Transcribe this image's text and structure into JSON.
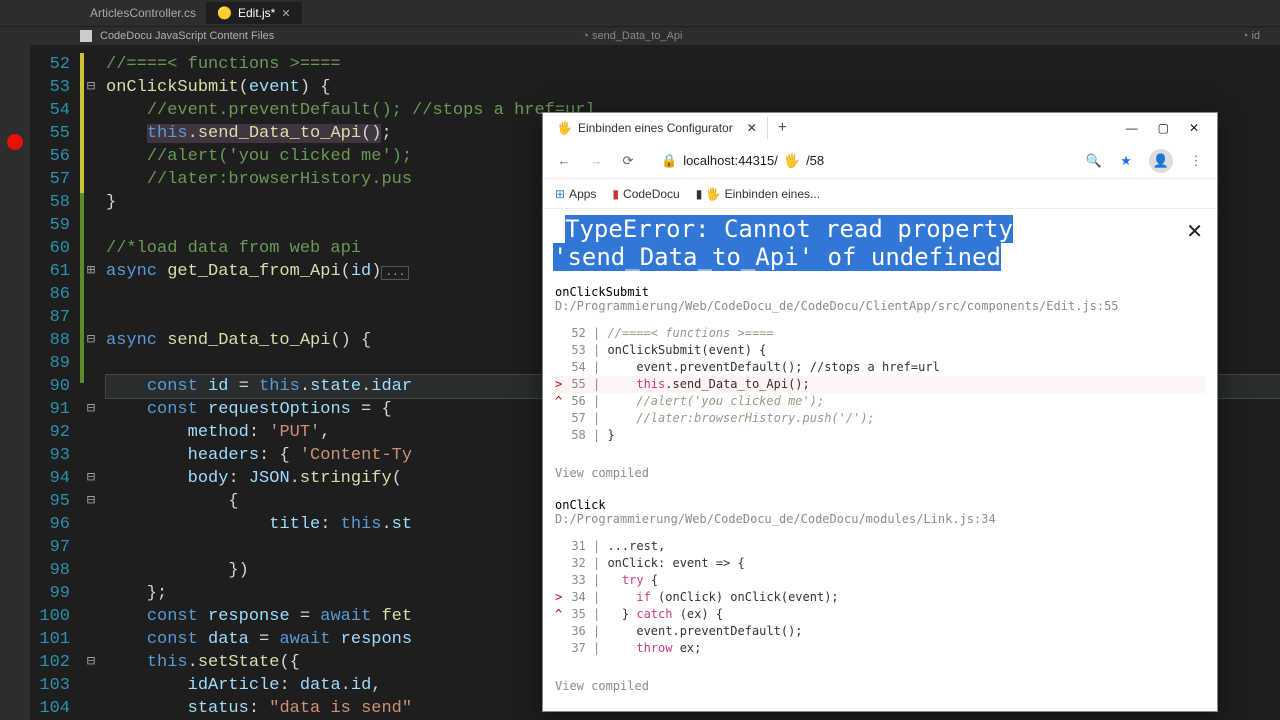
{
  "tabs": [
    {
      "label": "ArticlesController.cs",
      "active": false
    },
    {
      "label": "Edit.js*",
      "icon": "🟡",
      "active": true,
      "closeable": true
    }
  ],
  "docfiles": {
    "left": "CodeDocu JavaScript Content Files",
    "mid": "send_Data_to_Api",
    "right": "id"
  },
  "line_numbers": [
    "52",
    "53",
    "54",
    "55",
    "56",
    "57",
    "58",
    "59",
    "60",
    "61",
    "86",
    "87",
    "88",
    "89",
    "90",
    "91",
    "92",
    "93",
    "94",
    "95",
    "96",
    "97",
    "98",
    "99",
    "100",
    "101",
    "102",
    "103",
    "104"
  ],
  "fold_marks": [
    "",
    "-",
    "",
    "",
    "",
    "",
    "",
    "",
    "",
    "+",
    "",
    "",
    "-",
    "",
    "",
    "-",
    "",
    "",
    "-",
    "-",
    "",
    "",
    "",
    "",
    "",
    "",
    "-",
    "",
    ""
  ],
  "code_lines": [
    {
      "html": "<span class='c-comment'>//====&lt; functions &gt;====</span>"
    },
    {
      "html": "<span class='c-method'>onClickSubmit</span>(<span class='c-var'>event</span>) {"
    },
    {
      "html": "    <span class='c-comment'>//event.preventDefault(); //stops a href=url</span>"
    },
    {
      "html": "    <span class='c-hilite'><span class='c-keyword'>this</span>.<span class='c-method'>send_Data_to_Api</span>()</span>;"
    },
    {
      "html": "    <span class='c-comment'>//alert('you clicked me');</span>"
    },
    {
      "html": "    <span class='c-comment'>//later:browserHistory.pus</span>"
    },
    {
      "html": "}"
    },
    {
      "html": ""
    },
    {
      "html": "<span class='c-comment'>//*load data from web api</span>"
    },
    {
      "html": "<span class='c-keyword'>async</span> <span class='c-method'>get_Data_from_Api</span>(<span class='c-var'>id</span>)<span class='c-dots'>...</span>"
    },
    {
      "html": ""
    },
    {
      "html": ""
    },
    {
      "html": "<span class='c-keyword'>async</span> <span class='c-method'>send_Data_to_Api</span>() {"
    },
    {
      "html": ""
    },
    {
      "html": "    <span class='c-keyword'>const</span> <span class='c-var'>id</span> = <span class='c-keyword'>this</span>.<span class='c-var'>state</span>.<span class='c-var'>idar</span>",
      "current": true
    },
    {
      "html": "    <span class='c-keyword'>const</span> <span class='c-var'>requestOptions</span> = {"
    },
    {
      "html": "        <span class='c-var'>method</span>: <span class='c-string'>'PUT'</span>,"
    },
    {
      "html": "        <span class='c-var'>headers</span>: { <span class='c-string'>'Content-Ty</span>"
    },
    {
      "html": "        <span class='c-var'>body</span>: <span class='c-var'>JSON</span>.<span class='c-method'>stringify</span>("
    },
    {
      "html": "            {"
    },
    {
      "html": "                <span class='c-var'>title</span>: <span class='c-keyword'>this</span>.<span class='c-var'>st</span>"
    },
    {
      "html": ""
    },
    {
      "html": "            })"
    },
    {
      "html": "    };"
    },
    {
      "html": "    <span class='c-keyword'>const</span> <span class='c-var'>response</span> = <span class='c-keyword'>await</span> <span class='c-method'>fet</span>"
    },
    {
      "html": "    <span class='c-keyword'>const</span> <span class='c-var'>data</span> = <span class='c-keyword'>await</span> <span class='c-var'>respons</span>"
    },
    {
      "html": "    <span class='c-keyword'>this</span>.<span class='c-method'>setState</span>({"
    },
    {
      "html": "        <span class='c-var'>idArticle</span>: <span class='c-var'>data</span>.<span class='c-var'>id</span>,"
    },
    {
      "html": "        <span class='c-var'>status</span>: <span class='c-string'>\"data is send\"</span>"
    }
  ],
  "browser": {
    "tab_title": "Einbinden eines Configurator",
    "url_host": "localhost:44315/",
    "url_path": "/58",
    "url_icon": "🖐️",
    "bookmarks": {
      "apps": "Apps",
      "codedocu": "CodeDocu",
      "einbinden": "Einbinden eines..."
    },
    "error_title": "TypeError: Cannot read property 'send_Data_to_Api' of undefined",
    "stack1": {
      "name": "onClickSubmit",
      "path": "D:/Programmierung/Web/CodeDocu_de/CodeDocu/ClientApp/src/components/Edit.js:55",
      "lines": [
        {
          "n": "52",
          "t": "//====< functions >====",
          "cls": "cm"
        },
        {
          "n": "53",
          "t": "onClickSubmit(event) {"
        },
        {
          "n": "54",
          "t": "    event.preventDefault(); //stops a href=url"
        },
        {
          "n": "55",
          "t": "    this.send_Data_to_Api();",
          "mark": ">",
          "kw": "this",
          "hi": true
        },
        {
          "n": "56",
          "t": "    //alert('you clicked me');",
          "mark": "^",
          "cls": "cm"
        },
        {
          "n": "57",
          "t": "    //later:browserHistory.push('/');",
          "cls": "cm"
        },
        {
          "n": "58",
          "t": "}"
        }
      ]
    },
    "stack2": {
      "name": "onClick",
      "path": "D:/Programmierung/Web/CodeDocu_de/CodeDocu/modules/Link.js:34",
      "lines": [
        {
          "n": "31",
          "t": "...rest,"
        },
        {
          "n": "32",
          "t": "onClick: event => {"
        },
        {
          "n": "33",
          "t": "  try {",
          "kw": "try"
        },
        {
          "n": "34",
          "t": "    if (onClick) onClick(event);",
          "mark": ">",
          "kw": "if"
        },
        {
          "n": "35",
          "t": "  } catch (ex) {",
          "mark": "^",
          "kw": "catch"
        },
        {
          "n": "36",
          "t": "    event.preventDefault();"
        },
        {
          "n": "37",
          "t": "    throw ex;",
          "kw": "throw"
        }
      ]
    },
    "view_compiled": "View compiled"
  }
}
